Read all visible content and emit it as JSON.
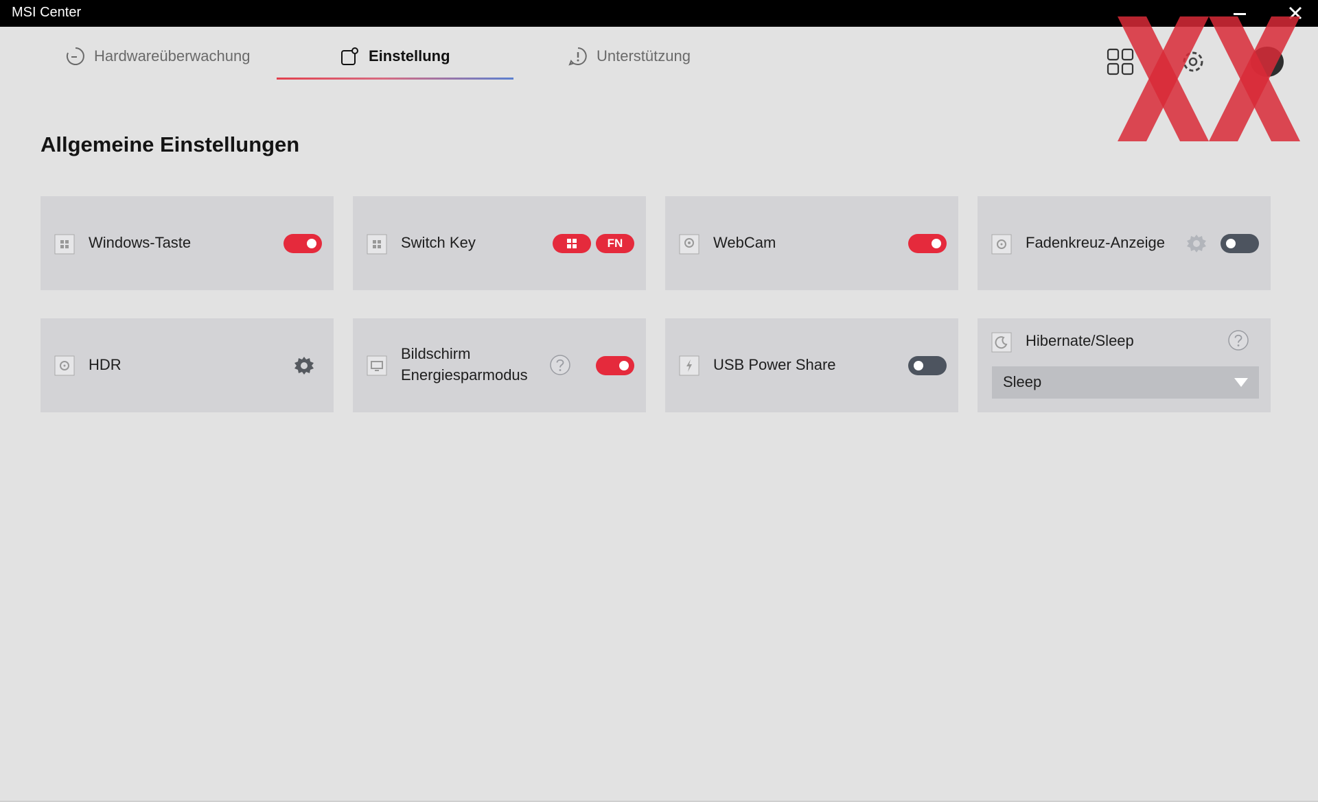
{
  "window": {
    "title": "MSI Center"
  },
  "tabs": [
    {
      "label": "Hardwareüberwachung",
      "icon": "gauge-icon",
      "active": false
    },
    {
      "label": "Einstellung",
      "icon": "settings-tab-icon",
      "active": true
    },
    {
      "label": "Unterstützung",
      "icon": "support-icon",
      "active": false
    }
  ],
  "header_icons": [
    "apps-grid-icon",
    "gear-icon",
    "avatar"
  ],
  "section": {
    "title": "Allgemeine Einstellungen"
  },
  "cards": [
    {
      "label": "Windows-Taste",
      "icon": "windows-key-icon",
      "control": "toggle",
      "state": "on"
    },
    {
      "label": "Switch Key",
      "icon": "switch-key-icon",
      "control": "pills",
      "pills": [
        "windows-logo-icon",
        "FN"
      ]
    },
    {
      "label": "WebCam",
      "icon": "webcam-icon",
      "control": "toggle",
      "state": "on"
    },
    {
      "label": "Fadenkreuz-Anzeige",
      "icon": "crosshair-icon",
      "control": "gear+toggle",
      "state": "off"
    },
    {
      "label": "HDR",
      "icon": "hdr-icon",
      "control": "gear"
    },
    {
      "label_line1": "Bildschirm",
      "label_line2": "Energiesparmodus",
      "icon": "monitor-icon",
      "control": "help+toggle",
      "state": "on"
    },
    {
      "label": "USB Power Share",
      "icon": "usb-power-icon",
      "control": "toggle",
      "state": "off"
    },
    {
      "label": "Hibernate/Sleep",
      "icon": "sleep-icon",
      "control": "help+select",
      "selected": "Sleep"
    }
  ],
  "pill_fn": "FN",
  "colors": {
    "accent": "#e52a3c",
    "toggle_off": "#4d545f",
    "card_bg": "#d3d3d6",
    "page_bg": "#e2e2e2"
  }
}
